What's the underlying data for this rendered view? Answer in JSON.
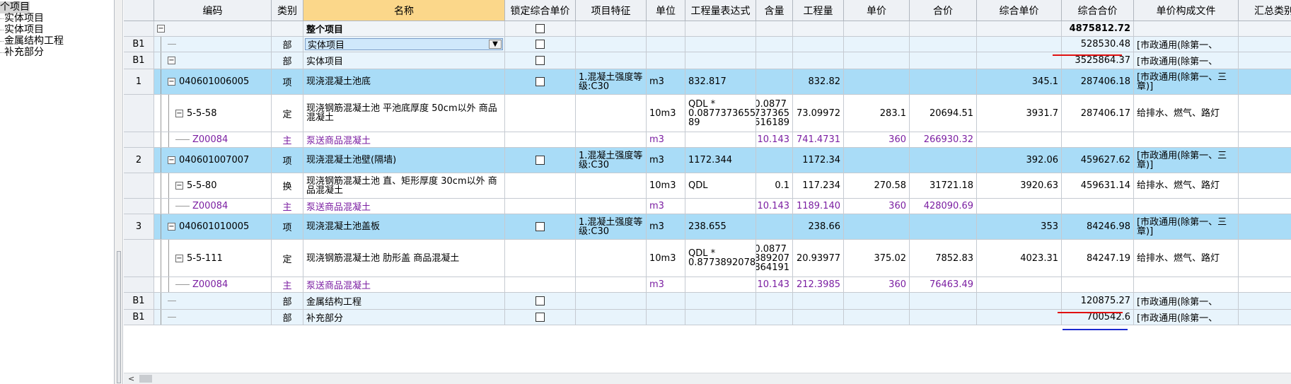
{
  "tree": {
    "nodes": [
      {
        "label": "个项目",
        "selected": true
      },
      {
        "label": "实体项目"
      },
      {
        "label": "实体项目"
      },
      {
        "label": "金属结构工程"
      },
      {
        "label": "补充部分"
      }
    ]
  },
  "grid": {
    "columns": [
      {
        "label": "",
        "key": "idx"
      },
      {
        "label": "编码",
        "key": "code"
      },
      {
        "label": "类别",
        "key": "type"
      },
      {
        "label": "名称",
        "key": "name",
        "highlight": true
      },
      {
        "label": "锁定综合单价",
        "key": "lock"
      },
      {
        "label": "项目特征",
        "key": "feat"
      },
      {
        "label": "单位",
        "key": "unit"
      },
      {
        "label": "工程量表达式",
        "key": "expr"
      },
      {
        "label": "含量",
        "key": "content"
      },
      {
        "label": "工程量",
        "key": "qty"
      },
      {
        "label": "单价",
        "key": "price"
      },
      {
        "label": "合价",
        "key": "amount"
      },
      {
        "label": "综合单价",
        "key": "cprice"
      },
      {
        "label": "综合合价",
        "key": "camount"
      },
      {
        "label": "单价构成文件",
        "key": "file"
      },
      {
        "label": "汇总类别",
        "key": "sumtype"
      }
    ],
    "rows": [
      {
        "kind": "top",
        "idx": "",
        "code": "",
        "type": "",
        "name": "整个项目",
        "lock": true,
        "feat": "",
        "unit": "",
        "expr": "",
        "content": "",
        "qty": "",
        "price": "",
        "amount": "",
        "cprice": "",
        "camount": "4875812.72",
        "file": ""
      },
      {
        "kind": "part",
        "idx": "B1",
        "code": "",
        "type": "部",
        "name": "实体项目",
        "lock": true,
        "combo": true,
        "feat": "",
        "unit": "",
        "expr": "",
        "content": "",
        "qty": "",
        "price": "",
        "amount": "",
        "cprice": "",
        "camount": "528530.48",
        "file": "[市政通用(除第一、"
      },
      {
        "kind": "part",
        "idx": "B1",
        "code": "",
        "type": "部",
        "name": "实体项目",
        "lock": true,
        "feat": "",
        "unit": "",
        "expr": "",
        "content": "",
        "qty": "",
        "price": "",
        "amount": "",
        "cprice": "",
        "camount": "3525864.37",
        "file": "[市政通用(除第一、"
      },
      {
        "kind": "item",
        "idx": "1",
        "code": "040601006005",
        "type": "项",
        "name": "现浇混凝土池底",
        "lock": true,
        "feat": "1.混凝土强度等级:C30",
        "unit": "m3",
        "expr": "832.817",
        "content": "",
        "qty": "832.82",
        "price": "",
        "amount": "",
        "cprice": "345.1",
        "camount": "287406.18",
        "file": "[市政通用(除第一、三章)]"
      },
      {
        "kind": "sub",
        "idx": "",
        "code": "5-5-58",
        "type": "定",
        "name": "现浇钢筋混凝土池 平池底厚度 50cm以外 商品混凝土",
        "feat": "",
        "unit": "10m3",
        "expr": "QDL * 0.0877373655161 89",
        "content": "0.0877 737365 516189",
        "qty": "73.09972",
        "price": "283.1",
        "amount": "20694.51",
        "cprice": "3931.7",
        "camount": "287406.17",
        "file": "给排水、燃气、路灯"
      },
      {
        "kind": "main",
        "idx": "",
        "code": "Z00084",
        "type": "主",
        "name": "泵送商品混凝土",
        "feat": "",
        "unit": "m3",
        "expr": "",
        "content": "10.143",
        "qty": "741.4731",
        "price": "360",
        "amount": "266930.32",
        "cprice": "",
        "camount": "",
        "file": ""
      },
      {
        "kind": "item",
        "idx": "2",
        "code": "040601007007",
        "type": "项",
        "name": "现浇混凝土池壁(隔墙)",
        "lock": true,
        "feat": "1.混凝土强度等级:C30",
        "unit": "m3",
        "expr": "1172.344",
        "content": "",
        "qty": "1172.34",
        "price": "",
        "amount": "",
        "cprice": "392.06",
        "camount": "459627.62",
        "file": "[市政通用(除第一、三章)]"
      },
      {
        "kind": "sub",
        "idx": "",
        "code": "5-5-80",
        "type": "换",
        "name": "现浇钢筋混凝土池 直、矩形厚度 30cm以外 商品混凝土",
        "feat": "",
        "unit": "10m3",
        "expr": "QDL",
        "content": "0.1",
        "qty": "117.234",
        "price": "270.58",
        "amount": "31721.18",
        "cprice": "3920.63",
        "camount": "459631.14",
        "file": "给排水、燃气、路灯"
      },
      {
        "kind": "main",
        "idx": "",
        "code": "Z00084",
        "type": "主",
        "name": "泵送商品混凝土",
        "feat": "",
        "unit": "m3",
        "expr": "",
        "content": "10.143",
        "qty": "1189.140",
        "price": "360",
        "amount": "428090.69",
        "cprice": "",
        "camount": "",
        "file": ""
      },
      {
        "kind": "item",
        "idx": "3",
        "code": "040601010005",
        "type": "项",
        "name": "现浇混凝土池盖板",
        "lock": true,
        "feat": "1.混凝土强度等级:C30",
        "unit": "m3",
        "expr": "238.655",
        "content": "",
        "qty": "238.66",
        "price": "",
        "amount": "",
        "cprice": "353",
        "camount": "84246.98",
        "file": "[市政通用(除第一、三章)]"
      },
      {
        "kind": "sub",
        "idx": "",
        "code": "5-5-111",
        "type": "定",
        "name": "现浇钢筋混凝土池 肋形盖 商品混凝土",
        "feat": "",
        "unit": "10m3",
        "expr": "QDL * 0.877389207864191",
        "content": "0.0877 389207 864191",
        "qty": "20.93977",
        "price": "375.02",
        "amount": "7852.83",
        "cprice": "4023.31",
        "camount": "84247.19",
        "file": "给排水、燃气、路灯"
      },
      {
        "kind": "main",
        "idx": "",
        "code": "Z00084",
        "type": "主",
        "name": "泵送商品混凝土",
        "feat": "",
        "unit": "m3",
        "expr": "",
        "content": "10.143",
        "qty": "212.3985",
        "price": "360",
        "amount": "76463.49",
        "cprice": "",
        "camount": "",
        "file": ""
      },
      {
        "kind": "part",
        "idx": "B1",
        "code": "",
        "type": "部",
        "name": "金属结构工程",
        "lock": true,
        "feat": "",
        "unit": "",
        "expr": "",
        "content": "",
        "qty": "",
        "price": "",
        "amount": "",
        "cprice": "",
        "camount": "120875.27",
        "file": "[市政通用(除第一、"
      },
      {
        "kind": "part",
        "idx": "B1",
        "code": "",
        "type": "部",
        "name": "补充部分",
        "lock": true,
        "feat": "",
        "unit": "",
        "expr": "",
        "content": "",
        "qty": "",
        "price": "",
        "amount": "",
        "cprice": "",
        "camount": "700542.6",
        "file": "[市政通用(除第一、"
      }
    ]
  },
  "colors": {
    "item_row": "#a9dcf7",
    "part_row": "#e8f4fc",
    "name_header": "#fbd78a",
    "main_material_text": "#7b1fa2",
    "annotation_red": "#e01010",
    "annotation_blue": "#1c2bd0"
  }
}
